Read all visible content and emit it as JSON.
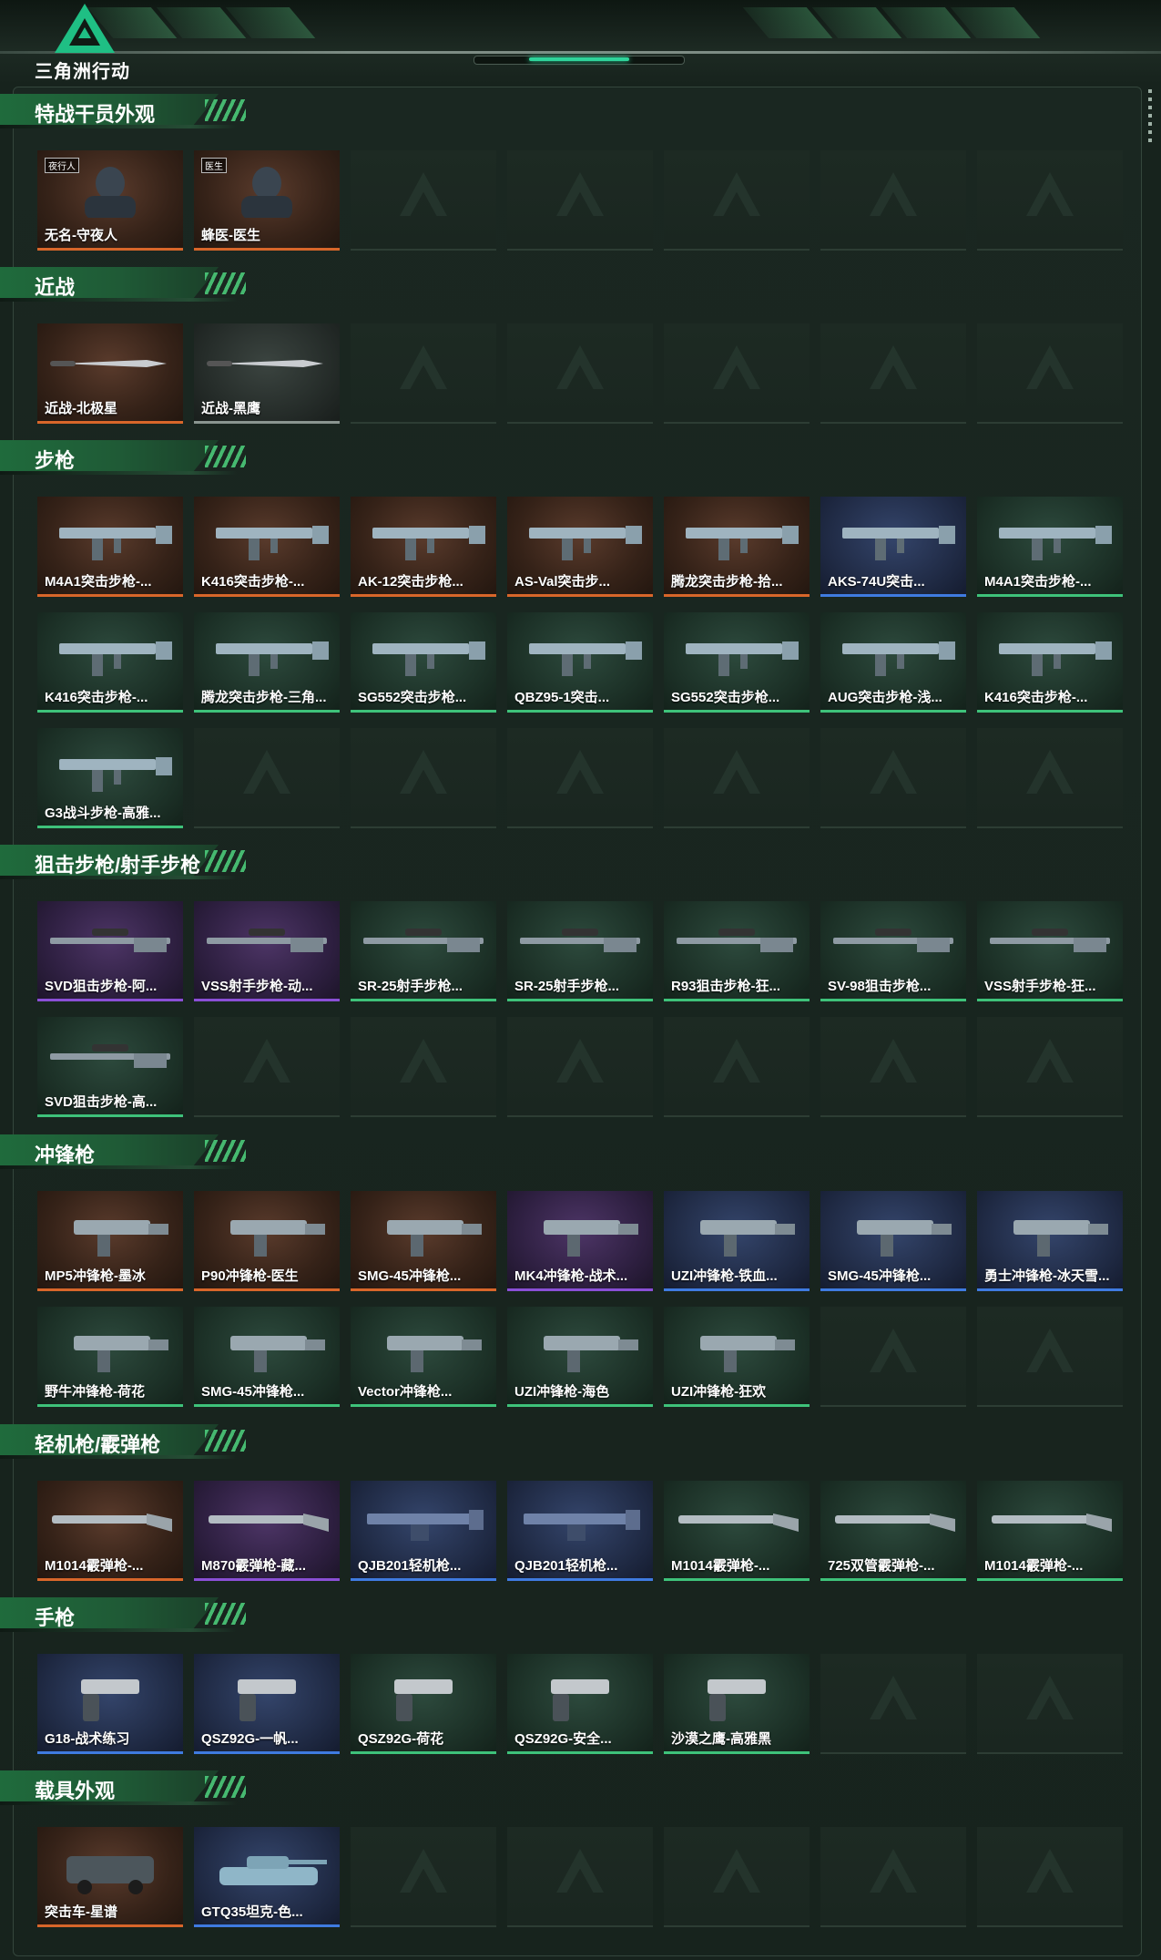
{
  "app": {
    "logo_text": "三角洲行动",
    "rarity_colors": {
      "orange": "#d8662a",
      "purple": "#8a4fd6",
      "blue": "#3f7be0",
      "green": "#3ec27a",
      "gray": "#8a9590"
    }
  },
  "sections": [
    {
      "title": "特战干员外观",
      "items": [
        {
          "name": "无名-守夜人",
          "rarity": "orange",
          "icon": "operator-portrait",
          "tag": "夜行人"
        },
        {
          "name": "蜂医-医生",
          "rarity": "orange",
          "icon": "operator-portrait",
          "tag": "医生"
        },
        null,
        null,
        null,
        null,
        null
      ]
    },
    {
      "title": "近战",
      "items": [
        {
          "name": "近战-北极星",
          "rarity": "orange",
          "icon": "knife-icon"
        },
        {
          "name": "近战-黑鹰",
          "rarity": "gray",
          "icon": "knife-icon"
        },
        null,
        null,
        null,
        null,
        null
      ]
    },
    {
      "title": "步枪",
      "items": [
        {
          "name": "M4A1突击步枪-...",
          "rarity": "orange",
          "icon": "rifle-icon"
        },
        {
          "name": "K416突击步枪-...",
          "rarity": "orange",
          "icon": "rifle-icon"
        },
        {
          "name": "AK-12突击步枪...",
          "rarity": "orange",
          "icon": "rifle-icon"
        },
        {
          "name": "AS-Val突击步...",
          "rarity": "orange",
          "icon": "rifle-icon"
        },
        {
          "name": "腾龙突击步枪-拾...",
          "rarity": "orange",
          "icon": "rifle-icon"
        },
        {
          "name": "AKS-74U突击...",
          "rarity": "blue",
          "icon": "rifle-icon"
        },
        {
          "name": "M4A1突击步枪-...",
          "rarity": "green",
          "icon": "rifle-icon"
        },
        {
          "name": "K416突击步枪-...",
          "rarity": "green",
          "icon": "rifle-icon"
        },
        {
          "name": "腾龙突击步枪-三角...",
          "rarity": "green",
          "icon": "rifle-icon"
        },
        {
          "name": "SG552突击步枪...",
          "rarity": "green",
          "icon": "rifle-icon"
        },
        {
          "name": "QBZ95-1突击...",
          "rarity": "green",
          "icon": "rifle-icon"
        },
        {
          "name": "SG552突击步枪...",
          "rarity": "green",
          "icon": "rifle-icon"
        },
        {
          "name": "AUG突击步枪-浅...",
          "rarity": "green",
          "icon": "rifle-icon"
        },
        {
          "name": "K416突击步枪-...",
          "rarity": "green",
          "icon": "rifle-icon"
        },
        {
          "name": "G3战斗步枪-高雅...",
          "rarity": "green",
          "icon": "rifle-icon"
        },
        null,
        null,
        null,
        null,
        null,
        null
      ]
    },
    {
      "title": "狙击步枪/射手步枪",
      "items": [
        {
          "name": "SVD狙击步枪-阿...",
          "rarity": "purple",
          "icon": "sniper-icon"
        },
        {
          "name": "VSS射手步枪-动...",
          "rarity": "purple",
          "icon": "sniper-icon"
        },
        {
          "name": "SR-25射手步枪...",
          "rarity": "green",
          "icon": "sniper-icon"
        },
        {
          "name": "SR-25射手步枪...",
          "rarity": "green",
          "icon": "sniper-icon"
        },
        {
          "name": "R93狙击步枪-狂...",
          "rarity": "green",
          "icon": "sniper-icon"
        },
        {
          "name": "SV-98狙击步枪...",
          "rarity": "green",
          "icon": "sniper-icon"
        },
        {
          "name": "VSS射手步枪-狂...",
          "rarity": "green",
          "icon": "sniper-icon"
        },
        {
          "name": "SVD狙击步枪-高...",
          "rarity": "green",
          "icon": "sniper-icon"
        },
        null,
        null,
        null,
        null,
        null,
        null
      ]
    },
    {
      "title": "冲锋枪",
      "items": [
        {
          "name": "MP5冲锋枪-墨冰",
          "rarity": "orange",
          "icon": "smg-icon"
        },
        {
          "name": "P90冲锋枪-医生",
          "rarity": "orange",
          "icon": "smg-icon"
        },
        {
          "name": "SMG-45冲锋枪...",
          "rarity": "orange",
          "icon": "smg-icon"
        },
        {
          "name": "MK4冲锋枪-战术...",
          "rarity": "purple",
          "icon": "smg-icon"
        },
        {
          "name": "UZI冲锋枪-铁血...",
          "rarity": "blue",
          "icon": "smg-icon"
        },
        {
          "name": "SMG-45冲锋枪...",
          "rarity": "blue",
          "icon": "smg-icon"
        },
        {
          "name": "勇士冲锋枪-冰天雪...",
          "rarity": "blue",
          "icon": "smg-icon"
        },
        {
          "name": "野牛冲锋枪-荷花",
          "rarity": "green",
          "icon": "smg-icon"
        },
        {
          "name": "SMG-45冲锋枪...",
          "rarity": "green",
          "icon": "smg-icon"
        },
        {
          "name": "Vector冲锋枪...",
          "rarity": "green",
          "icon": "smg-icon"
        },
        {
          "name": "UZI冲锋枪-海色",
          "rarity": "green",
          "icon": "smg-icon"
        },
        {
          "name": "UZI冲锋枪-狂欢",
          "rarity": "green",
          "icon": "smg-icon"
        },
        null,
        null
      ]
    },
    {
      "title": "轻机枪/霰弹枪",
      "items": [
        {
          "name": "M1014霰弹枪-...",
          "rarity": "orange",
          "icon": "shotgun-icon"
        },
        {
          "name": "M870霰弹枪-藏...",
          "rarity": "purple",
          "icon": "shotgun-icon"
        },
        {
          "name": "QJB201轻机枪...",
          "rarity": "blue",
          "icon": "lmg-icon"
        },
        {
          "name": "QJB201轻机枪...",
          "rarity": "blue",
          "icon": "lmg-icon"
        },
        {
          "name": "M1014霰弹枪-...",
          "rarity": "green",
          "icon": "shotgun-icon"
        },
        {
          "name": "725双管霰弹枪-...",
          "rarity": "green",
          "icon": "shotgun-icon"
        },
        {
          "name": "M1014霰弹枪-...",
          "rarity": "green",
          "icon": "shotgun-icon"
        }
      ]
    },
    {
      "title": "手枪",
      "items": [
        {
          "name": "G18-战术练习",
          "rarity": "blue",
          "icon": "pistol-icon"
        },
        {
          "name": "QSZ92G-一帆...",
          "rarity": "blue",
          "icon": "pistol-icon"
        },
        {
          "name": "QSZ92G-荷花",
          "rarity": "green",
          "icon": "pistol-icon"
        },
        {
          "name": "QSZ92G-安全...",
          "rarity": "green",
          "icon": "pistol-icon"
        },
        {
          "name": "沙漠之鹰-高雅黑",
          "rarity": "green",
          "icon": "pistol-icon"
        },
        null,
        null
      ]
    },
    {
      "title": "载具外观",
      "items": [
        {
          "name": "突击车-星谱",
          "rarity": "orange",
          "icon": "vehicle-icon"
        },
        {
          "name": "GTQ35坦克-色...",
          "rarity": "blue",
          "icon": "tank-icon"
        },
        null,
        null,
        null,
        null,
        null
      ]
    }
  ]
}
